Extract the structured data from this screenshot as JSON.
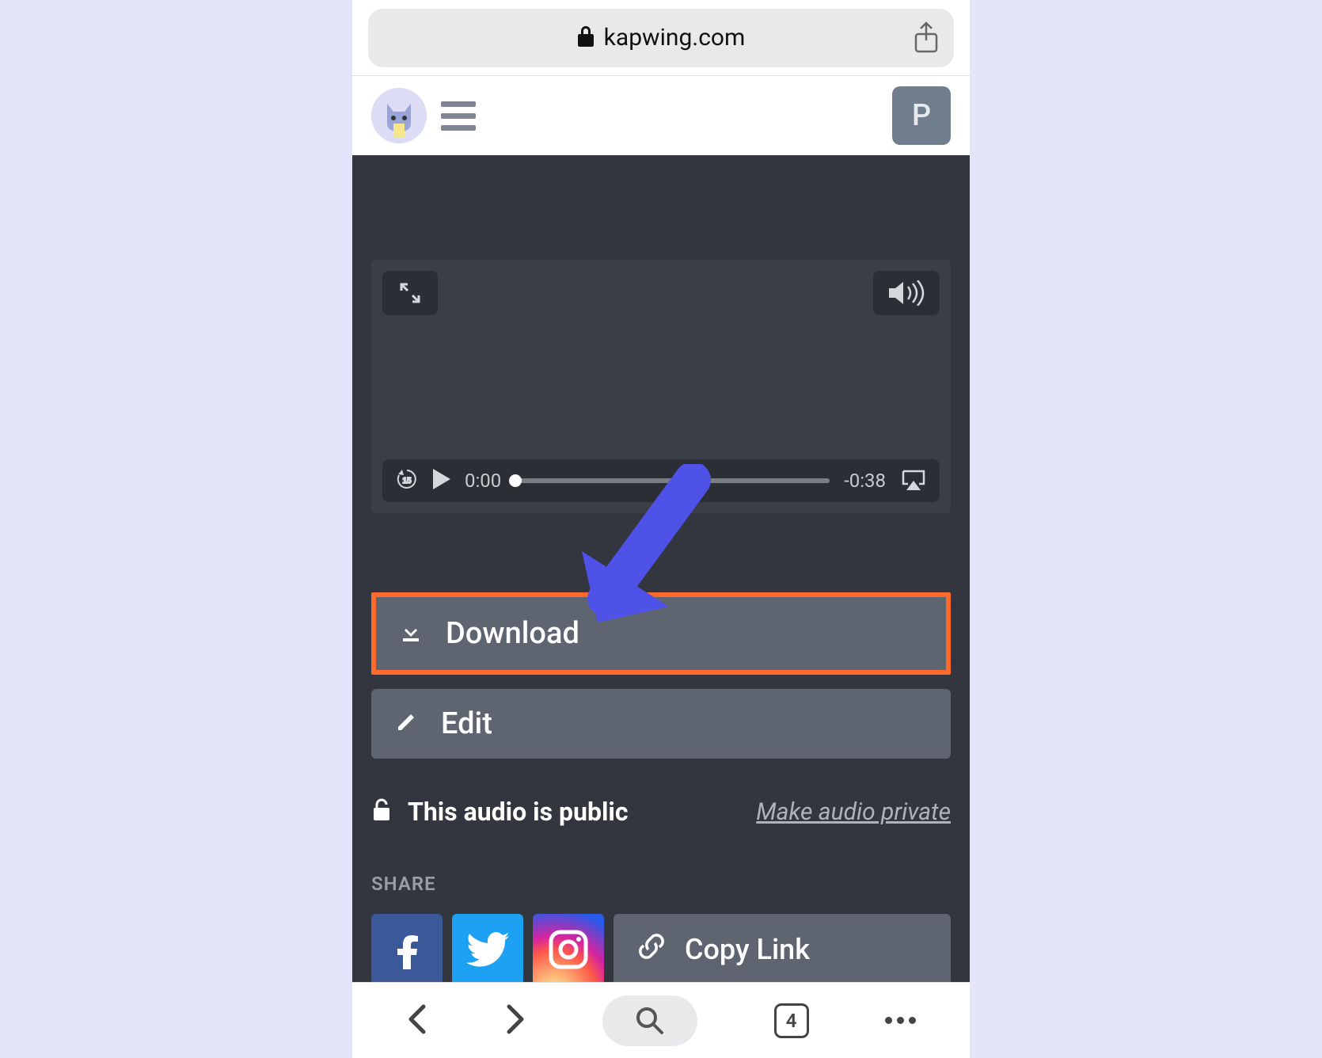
{
  "safari": {
    "url": "kapwing.com",
    "tab_count": "4"
  },
  "header": {
    "user_initial": "P"
  },
  "player": {
    "current_time": "0:00",
    "remaining_time": "-0:38"
  },
  "actions": {
    "download_label": "Download",
    "edit_label": "Edit"
  },
  "privacy": {
    "status_text": "This audio is public",
    "link_text": "Make audio private"
  },
  "share": {
    "heading": "SHARE",
    "copy_link_label": "Copy Link"
  }
}
